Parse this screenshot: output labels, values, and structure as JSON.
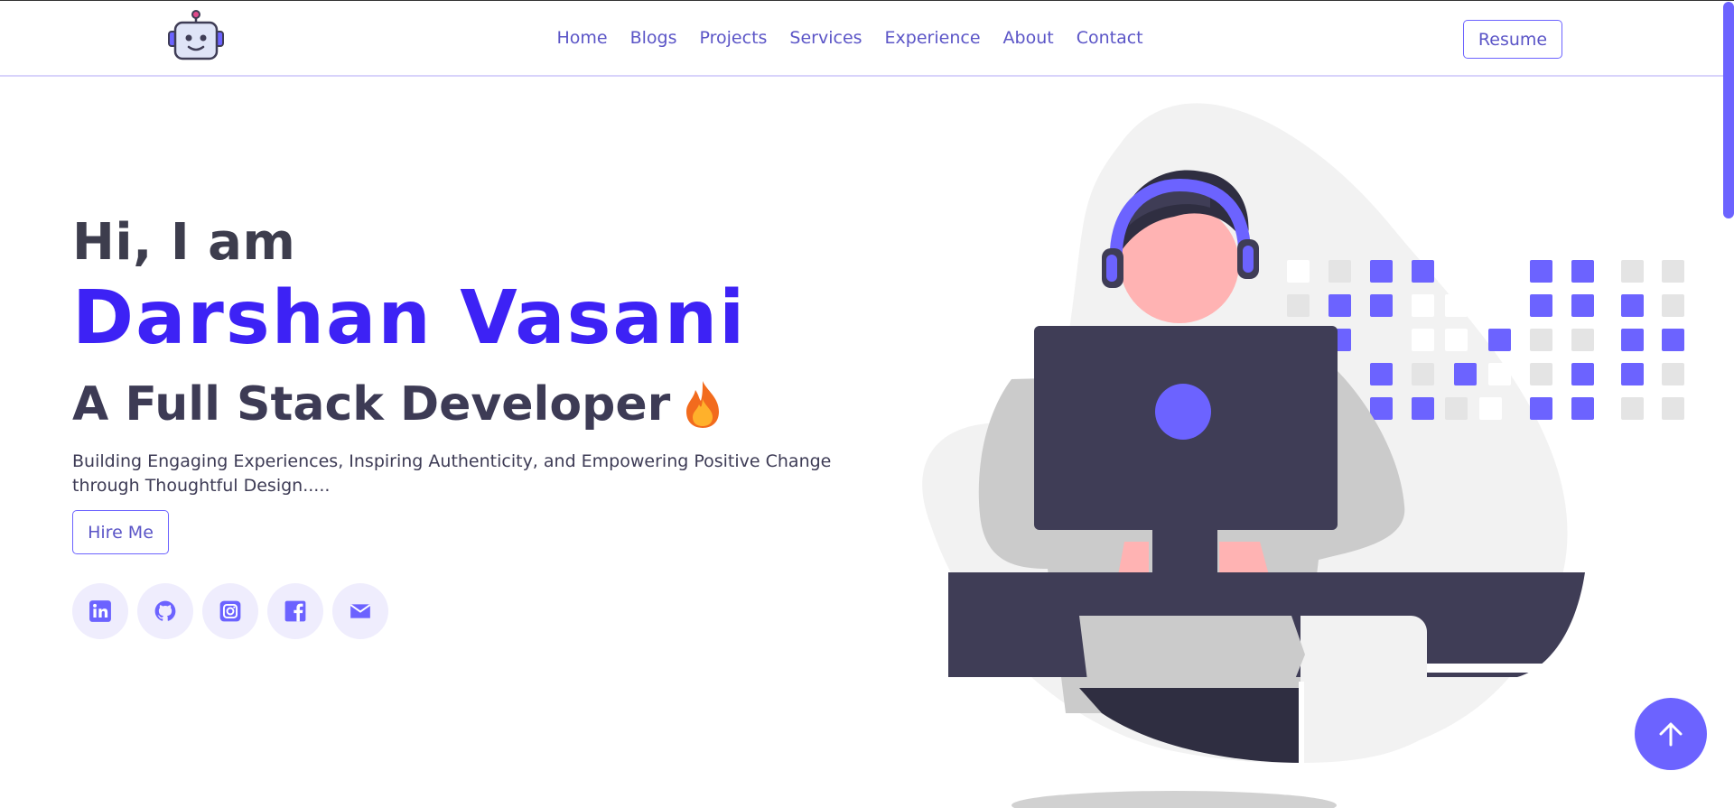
{
  "nav": {
    "items": [
      {
        "label": "Home"
      },
      {
        "label": "Blogs"
      },
      {
        "label": "Projects"
      },
      {
        "label": "Services"
      },
      {
        "label": "Experience"
      },
      {
        "label": "About"
      },
      {
        "label": "Contact"
      }
    ],
    "resume_label": "Resume"
  },
  "hero": {
    "greeting": "Hi, I am",
    "name": "Darshan Vasani",
    "role": "A Full Stack Developer",
    "description": "Building Engaging Experiences, Inspiring Authenticity, and Empowering Positive Change through Thoughtful Design.....",
    "hire_label": "Hire Me"
  },
  "socials": [
    {
      "icon": "linkedin-icon"
    },
    {
      "icon": "github-icon"
    },
    {
      "icon": "instagram-icon"
    },
    {
      "icon": "facebook-icon"
    },
    {
      "icon": "email-icon"
    }
  ],
  "colors": {
    "accent": "#6c63ff",
    "name": "#3d22f5",
    "nav_text": "#5b55c7",
    "dark": "#3f3d56"
  }
}
